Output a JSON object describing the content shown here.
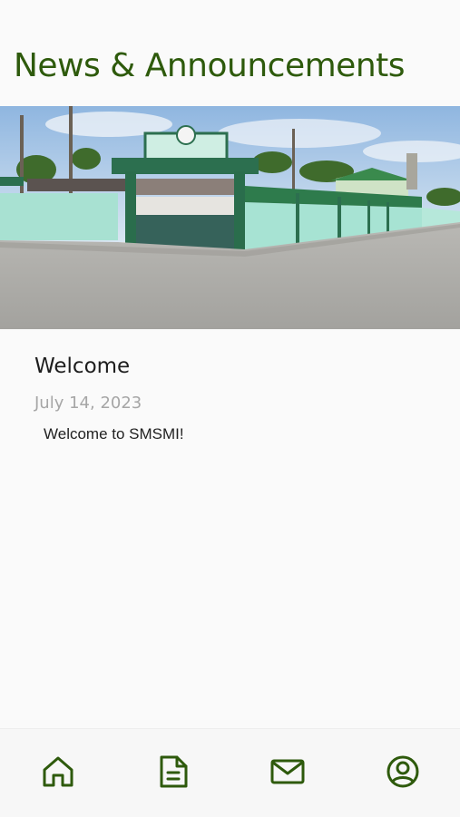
{
  "header": {
    "title": "News & Announcements"
  },
  "hero": {
    "description": "school gate photo"
  },
  "post": {
    "title": "Welcome",
    "date": "July 14, 2023",
    "body": "Welcome to SMSMI!"
  },
  "nav": {
    "accent": "#2e5a0c",
    "items": [
      {
        "icon": "home-icon"
      },
      {
        "icon": "document-icon"
      },
      {
        "icon": "mail-icon"
      },
      {
        "icon": "profile-icon"
      }
    ]
  }
}
